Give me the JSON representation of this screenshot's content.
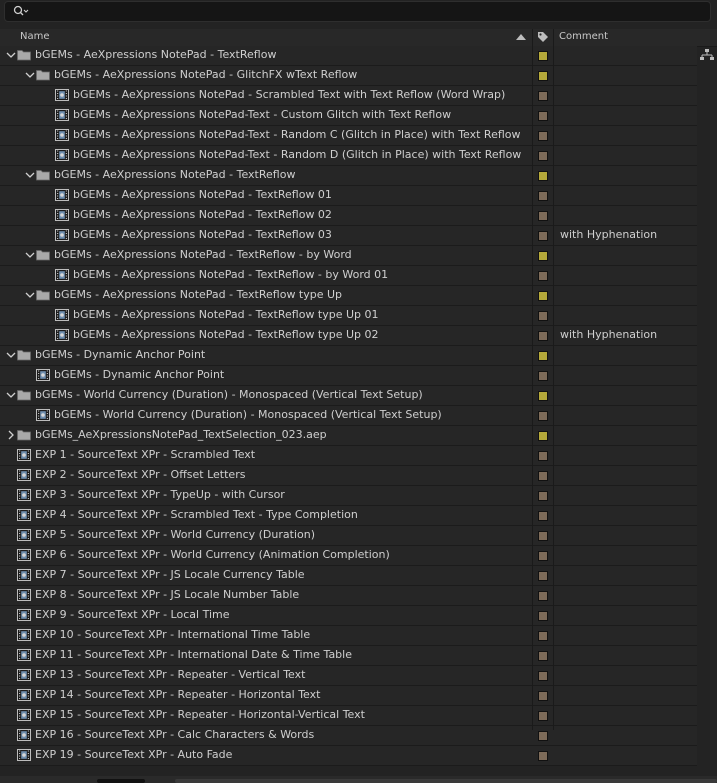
{
  "header": {
    "name_label": "Name",
    "comment_label": "Comment"
  },
  "colors": {
    "folder_label": "#b5a93a",
    "comp_label": "#7d6b59"
  },
  "rows": [
    {
      "level": 0,
      "type": "folder",
      "twirl": "open",
      "name": "bGEMs - AeXpressions NotePad - TextReflow",
      "label": "folder",
      "comment": ""
    },
    {
      "level": 1,
      "type": "folder",
      "twirl": "open",
      "name": "bGEMs - AeXpressions NotePad - GlitchFX wText Reflow",
      "label": "folder",
      "comment": ""
    },
    {
      "level": 2,
      "type": "comp",
      "twirl": "none",
      "name": "bGEMs - AeXpressions NotePad - Scrambled Text with Text Reflow (Word Wrap)",
      "label": "comp",
      "comment": ""
    },
    {
      "level": 2,
      "type": "comp",
      "twirl": "none",
      "name": "bGEMs - AeXpressions NotePad-Text - Custom Glitch with Text Reflow",
      "label": "comp",
      "comment": ""
    },
    {
      "level": 2,
      "type": "comp",
      "twirl": "none",
      "name": "bGEMs - AeXpressions NotePad-Text - Random C (Glitch in Place) with Text Reflow",
      "label": "comp",
      "comment": ""
    },
    {
      "level": 2,
      "type": "comp",
      "twirl": "none",
      "name": "bGEMs - AeXpressions NotePad-Text - Random D (Glitch in Place) with Text Reflow",
      "label": "comp",
      "comment": ""
    },
    {
      "level": 1,
      "type": "folder",
      "twirl": "open",
      "name": "bGEMs - AeXpressions NotePad - TextReflow",
      "label": "folder",
      "comment": ""
    },
    {
      "level": 2,
      "type": "comp",
      "twirl": "none",
      "name": "bGEMs - AeXpressions NotePad - TextReflow 01",
      "label": "comp",
      "comment": ""
    },
    {
      "level": 2,
      "type": "comp",
      "twirl": "none",
      "name": "bGEMs - AeXpressions NotePad - TextReflow 02",
      "label": "comp",
      "comment": ""
    },
    {
      "level": 2,
      "type": "comp",
      "twirl": "none",
      "name": "bGEMs - AeXpressions NotePad - TextReflow 03",
      "label": "comp",
      "comment": "with Hyphenation"
    },
    {
      "level": 1,
      "type": "folder",
      "twirl": "open",
      "name": "bGEMs - AeXpressions NotePad - TextReflow - by Word",
      "label": "folder",
      "comment": ""
    },
    {
      "level": 2,
      "type": "comp",
      "twirl": "none",
      "name": "bGEMs - AeXpressions NotePad - TextReflow - by Word 01",
      "label": "comp",
      "comment": ""
    },
    {
      "level": 1,
      "type": "folder",
      "twirl": "open",
      "name": "bGEMs - AeXpressions NotePad - TextReflow type Up",
      "label": "folder",
      "comment": ""
    },
    {
      "level": 2,
      "type": "comp",
      "twirl": "none",
      "name": "bGEMs - AeXpressions NotePad - TextReflow type Up 01",
      "label": "comp",
      "comment": ""
    },
    {
      "level": 2,
      "type": "comp",
      "twirl": "none",
      "name": "bGEMs - AeXpressions NotePad - TextReflow type Up 02",
      "label": "comp",
      "comment": "with Hyphenation"
    },
    {
      "level": 0,
      "type": "folder",
      "twirl": "open",
      "name": "bGEMs - Dynamic Anchor Point",
      "label": "folder",
      "comment": ""
    },
    {
      "level": 1,
      "type": "comp",
      "twirl": "none",
      "name": "bGEMs - Dynamic Anchor Point",
      "label": "comp",
      "comment": ""
    },
    {
      "level": 0,
      "type": "folder",
      "twirl": "open",
      "name": "bGEMs - World Currency (Duration) - Monospaced (Vertical Text Setup)",
      "label": "folder",
      "comment": ""
    },
    {
      "level": 1,
      "type": "comp",
      "twirl": "none",
      "name": "bGEMs - World Currency (Duration) - Monospaced (Vertical Text Setup)",
      "label": "comp",
      "comment": ""
    },
    {
      "level": 0,
      "type": "folder",
      "twirl": "closed",
      "name": "bGEMs_AeXpressionsNotePad_TextSelection_023.aep",
      "label": "folder",
      "comment": ""
    },
    {
      "level": 0,
      "type": "comp",
      "twirl": "none",
      "name": "EXP 1 - SourceText XPr - Scrambled Text",
      "label": "comp",
      "comment": ""
    },
    {
      "level": 0,
      "type": "comp",
      "twirl": "none",
      "name": "EXP 2 - SourceText XPr - Offset Letters",
      "label": "comp",
      "comment": ""
    },
    {
      "level": 0,
      "type": "comp",
      "twirl": "none",
      "name": "EXP 3 - SourceText XPr - TypeUp - with Cursor",
      "label": "comp",
      "comment": ""
    },
    {
      "level": 0,
      "type": "comp",
      "twirl": "none",
      "name": "EXP 4 - SourceText XPr - Scrambled Text - Type Completion",
      "label": "comp",
      "comment": ""
    },
    {
      "level": 0,
      "type": "comp",
      "twirl": "none",
      "name": "EXP 5 - SourceText XPr - World Currency (Duration)",
      "label": "comp",
      "comment": ""
    },
    {
      "level": 0,
      "type": "comp",
      "twirl": "none",
      "name": "EXP 6 - SourceText XPr - World Currency (Animation Completion)",
      "label": "comp",
      "comment": ""
    },
    {
      "level": 0,
      "type": "comp",
      "twirl": "none",
      "name": "EXP 7 - SourceText XPr - JS Locale Currency Table",
      "label": "comp",
      "comment": ""
    },
    {
      "level": 0,
      "type": "comp",
      "twirl": "none",
      "name": "EXP 8 - SourceText XPr - JS Locale Number Table",
      "label": "comp",
      "comment": ""
    },
    {
      "level": 0,
      "type": "comp",
      "twirl": "none",
      "name": "EXP 9 - SourceText XPr - Local Time",
      "label": "comp",
      "comment": ""
    },
    {
      "level": 0,
      "type": "comp",
      "twirl": "none",
      "name": "EXP 10 - SourceText XPr - International Time Table",
      "label": "comp",
      "comment": ""
    },
    {
      "level": 0,
      "type": "comp",
      "twirl": "none",
      "name": "EXP 11 - SourceText XPr - International Date & Time Table",
      "label": "comp",
      "comment": ""
    },
    {
      "level": 0,
      "type": "comp",
      "twirl": "none",
      "name": "EXP 13 - SourceText XPr - Repeater - Vertical Text",
      "label": "comp",
      "comment": ""
    },
    {
      "level": 0,
      "type": "comp",
      "twirl": "none",
      "name": "EXP 14 - SourceText XPr - Repeater - Horizontal Text",
      "label": "comp",
      "comment": ""
    },
    {
      "level": 0,
      "type": "comp",
      "twirl": "none",
      "name": "EXP 15 - SourceText XPr - Repeater - Horizontal-Vertical Text",
      "label": "comp",
      "comment": ""
    },
    {
      "level": 0,
      "type": "comp",
      "twirl": "none",
      "name": "EXP 16 - SourceText XPr - Calc Characters & Words",
      "label": "comp",
      "comment": ""
    },
    {
      "level": 0,
      "type": "comp",
      "twirl": "none",
      "name": "EXP 19 - SourceText XPr - Auto Fade",
      "label": "comp",
      "comment": ""
    }
  ]
}
